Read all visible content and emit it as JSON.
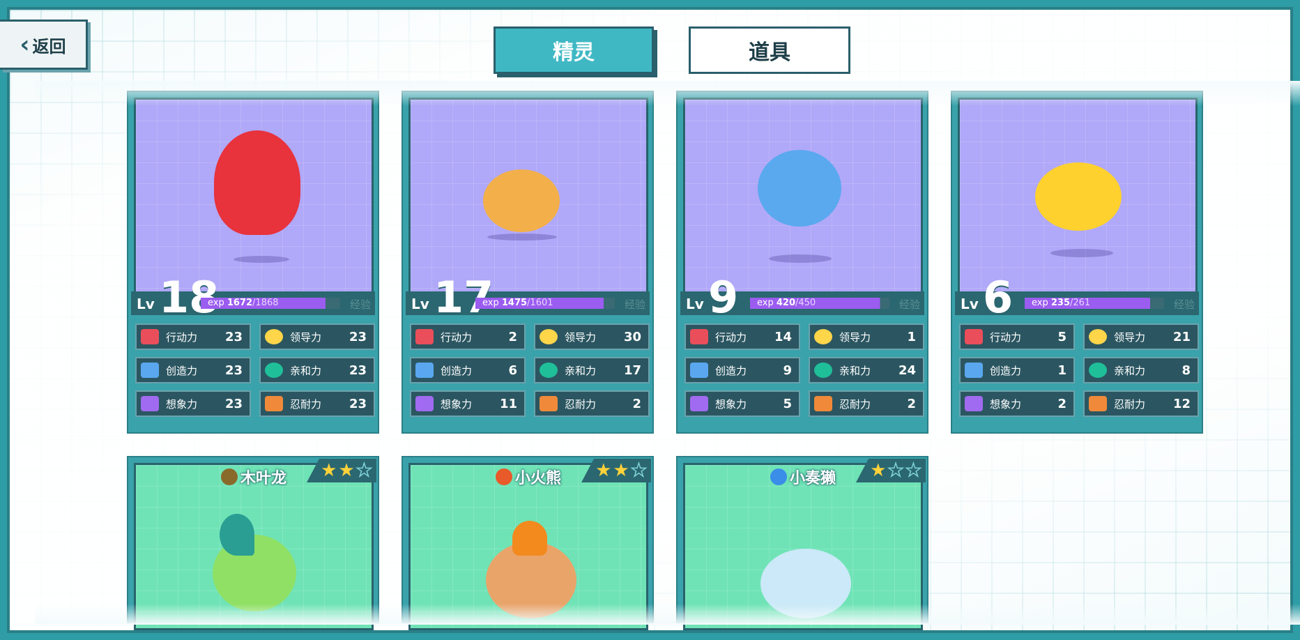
{
  "nav": {
    "back_label": "返回"
  },
  "tabs": [
    {
      "label": "精灵",
      "active": true
    },
    {
      "label": "道具",
      "active": false
    }
  ],
  "stat_labels": {
    "action": "行动力",
    "leadership": "领导力",
    "creativity": "创造力",
    "affinity": "亲和力",
    "imagination": "想象力",
    "endurance": "忍耐力"
  },
  "level_prefix": "Lv",
  "exp_prefix": "exp",
  "exp_label": "经验",
  "cards": [
    {
      "level": "18",
      "exp_current": "1672",
      "exp_total": "/1868",
      "exp_fraction": 0.895,
      "stats": {
        "action": "23",
        "leadership": "23",
        "creativity": "23",
        "affinity": "23",
        "imagination": "23",
        "endurance": "23"
      }
    },
    {
      "level": "17",
      "exp_current": "1475",
      "exp_total": "/1601",
      "exp_fraction": 0.921,
      "stats": {
        "action": "2",
        "leadership": "30",
        "creativity": "6",
        "affinity": "17",
        "imagination": "11",
        "endurance": "2"
      }
    },
    {
      "level": "9",
      "exp_current": "420",
      "exp_total": "/450",
      "exp_fraction": 0.933,
      "stats": {
        "action": "14",
        "leadership": "1",
        "creativity": "9",
        "affinity": "24",
        "imagination": "5",
        "endurance": "2"
      }
    },
    {
      "level": "6",
      "exp_current": "235",
      "exp_total": "/261",
      "exp_fraction": 0.9,
      "stats": {
        "action": "5",
        "leadership": "21",
        "creativity": "1",
        "affinity": "8",
        "imagination": "2",
        "endurance": "12"
      }
    }
  ],
  "bottom_cards": [
    {
      "name": "木叶龙",
      "element_icon": "leaf-icon",
      "element_color": "#8a6a2a",
      "stars": 2
    },
    {
      "name": "小火熊",
      "element_icon": "fire-icon",
      "element_color": "#e85a2a",
      "stars": 2
    },
    {
      "name": "小奏獭",
      "element_icon": "water-icon",
      "element_color": "#3a8ee8",
      "stars": 1
    }
  ],
  "colors": {
    "accent": "#3fb8c4",
    "exp_bar": "#9b5cf0",
    "card_art_purple": "#b0a8f8",
    "card_art_green": "#6fe3b6"
  }
}
